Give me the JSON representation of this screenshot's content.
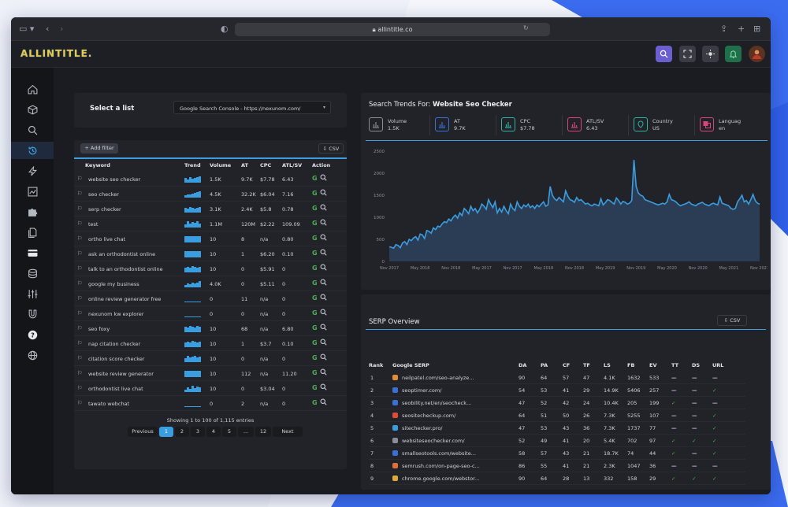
{
  "browser": {
    "url": "allintitle.co"
  },
  "app": {
    "logo": "ALLINTITLE."
  },
  "list": {
    "label": "Select a list",
    "selected": "Google Search Console - https://nexunom.com/"
  },
  "keywords": {
    "add_filter": "+ Add filter",
    "csv": "CSV",
    "columns": [
      "Keyword",
      "Trend",
      "Volume",
      "AT",
      "CPC",
      "ATL/SV",
      "Action"
    ],
    "rows": [
      {
        "kw": "website seo checker",
        "vol": "1.5K",
        "at": "9.7K",
        "cpc": "$7.78",
        "atsv": "6.43"
      },
      {
        "kw": "seo checker",
        "vol": "4.5K",
        "at": "32.2K",
        "cpc": "$6.04",
        "atsv": "7.16"
      },
      {
        "kw": "serp checker",
        "vol": "3.1K",
        "at": "2.4K",
        "cpc": "$5.8",
        "atsv": "0.78"
      },
      {
        "kw": "test",
        "vol": "1.1M",
        "at": "120M",
        "cpc": "$2.22",
        "atsv": "109.09"
      },
      {
        "kw": "ortho live chat",
        "vol": "10",
        "at": "8",
        "cpc": "n/a",
        "atsv": "0.80"
      },
      {
        "kw": "ask an orthodontist online",
        "vol": "10",
        "at": "1",
        "cpc": "$6.20",
        "atsv": "0.10"
      },
      {
        "kw": "talk to an orthodontist online",
        "vol": "10",
        "at": "0",
        "cpc": "$5.91",
        "atsv": "0"
      },
      {
        "kw": "google my business",
        "vol": "4.0K",
        "at": "0",
        "cpc": "$5.11",
        "atsv": "0"
      },
      {
        "kw": "online review generator free",
        "vol": "0",
        "at": "11",
        "cpc": "n/a",
        "atsv": "0"
      },
      {
        "kw": "nexunom kw explorer",
        "vol": "0",
        "at": "0",
        "cpc": "n/a",
        "atsv": "0"
      },
      {
        "kw": "seo foxy",
        "vol": "10",
        "at": "68",
        "cpc": "n/a",
        "atsv": "6.80"
      },
      {
        "kw": "nap citation checker",
        "vol": "10",
        "at": "1",
        "cpc": "$3.7",
        "atsv": "0.10"
      },
      {
        "kw": "citation score checker",
        "vol": "10",
        "at": "0",
        "cpc": "n/a",
        "atsv": "0"
      },
      {
        "kw": "website review generator",
        "vol": "10",
        "at": "112",
        "cpc": "n/a",
        "atsv": "11.20"
      },
      {
        "kw": "orthodontist live chat",
        "vol": "10",
        "at": "0",
        "cpc": "$3.04",
        "atsv": "0"
      },
      {
        "kw": "tawato webchat",
        "vol": "0",
        "at": "2",
        "cpc": "n/a",
        "atsv": "0"
      }
    ],
    "showing": "Showing 1 to 100 of 1,115 entries",
    "pagination": [
      "Previous",
      "1",
      "2",
      "3",
      "4",
      "5",
      "...",
      "12",
      "Next"
    ]
  },
  "trends": {
    "title_prefix": "Search Trends For:",
    "title_keyword": "Website Seo Checker",
    "metrics": [
      {
        "label": "Volume",
        "value": "1.5K",
        "color": "#8a8d95",
        "icon": "chart-icon"
      },
      {
        "label": "AT",
        "value": "9.7K",
        "color": "#3b6fd8",
        "icon": "chart-icon"
      },
      {
        "label": "CPC",
        "value": "$7.78",
        "color": "#2bb3a5",
        "icon": "chart-icon"
      },
      {
        "label": "ATL/SV",
        "value": "6.43",
        "color": "#d8457e",
        "icon": "chart-icon"
      },
      {
        "label": "Country",
        "value": "US",
        "color": "#2bb3a5",
        "icon": "pin-icon"
      },
      {
        "label": "Languag",
        "value": "en",
        "color": "#d8457e",
        "icon": "translate-icon"
      }
    ]
  },
  "chart_data": {
    "type": "area",
    "color": "#3a9de0",
    "yticks": [
      "0",
      "500",
      "1000",
      "1500",
      "2000",
      "2500"
    ],
    "xticks": [
      "Nov 2017",
      "May 2018",
      "Nov 2018",
      "May 2017",
      "Nov 2017",
      "May 2018",
      "Nov 2018",
      "May 2019",
      "Nov 2019",
      "May 2020",
      "Nov 2020",
      "May 2021",
      "Nov 2021"
    ],
    "ylim": [
      0,
      2500
    ],
    "values": [
      330,
      320,
      300,
      380,
      360,
      310,
      420,
      450,
      380,
      500,
      470,
      530,
      560,
      480,
      620,
      600,
      520,
      700,
      680,
      640,
      760,
      720,
      800,
      780,
      850,
      900,
      880,
      960,
      920,
      1000,
      1050,
      980,
      1100,
      1040,
      1200,
      1150,
      1080,
      1250,
      1150,
      1200,
      1100,
      1180,
      1300,
      1250,
      1180,
      1400,
      1300,
      1220,
      1350,
      1100,
      1200,
      1120,
      1250,
      1150,
      1080,
      1300,
      1200,
      1150,
      1350,
      1250,
      1200,
      1280,
      1240,
      1300,
      1220,
      1260,
      1200,
      1280,
      1240,
      1300,
      1350,
      1250,
      1280,
      1700,
      1500,
      1420,
      1380,
      1450,
      1400,
      1350,
      1600,
      1480,
      1400,
      1380,
      1340,
      1450,
      1380,
      1400,
      1350,
      1300,
      1320,
      1280,
      1260,
      1300,
      1280,
      1260,
      1420,
      1280,
      1330,
      1400,
      1380,
      1340,
      1300,
      1440,
      1380,
      1300,
      1360,
      1340,
      1300,
      1320,
      1380,
      2300,
      1700,
      1550,
      1500,
      1480,
      1400,
      1380,
      1360,
      1340,
      1320,
      1300,
      1280,
      1300,
      1320,
      1300,
      1350,
      1520,
      1400,
      1380,
      1350,
      1300,
      1260,
      1280,
      1300,
      1320,
      1350,
      1300,
      1280,
      1260,
      1300,
      1320,
      1340,
      1300,
      1280,
      1260,
      1300,
      1320,
      1300,
      1280,
      1460,
      1320,
      1300,
      1280,
      1260,
      1200,
      1180,
      1200,
      1350,
      1420,
      1500,
      1350,
      1380,
      1300,
      1400,
      1520,
      1380,
      1320,
      1300
    ]
  },
  "serp": {
    "title": "SERP Overview",
    "csv": "CSV",
    "columns": [
      "Rank",
      "Google SERP",
      "DA",
      "PA",
      "CF",
      "TF",
      "LS",
      "FB",
      "EV",
      "TT",
      "DS",
      "URL"
    ],
    "rows": [
      {
        "rank": "1",
        "url": "neilpatel.com/seo-analyze...",
        "da": "90",
        "pa": "64",
        "cf": "57",
        "tf": "47",
        "ls": "4.1K",
        "fb": "1632",
        "ev": "533",
        "icon_color": "#e08a3a",
        "tt": "—",
        "ds": "—",
        "u": "—"
      },
      {
        "rank": "2",
        "url": "seoptimer.com/",
        "da": "54",
        "pa": "53",
        "cf": "41",
        "tf": "29",
        "ls": "14.9K",
        "fb": "5406",
        "ev": "257",
        "icon_color": "#3b6fd8",
        "tt": "—",
        "ds": "—",
        "u": "✓"
      },
      {
        "rank": "3",
        "url": "seobility.net/en/seocheck...",
        "da": "47",
        "pa": "52",
        "cf": "42",
        "tf": "24",
        "ls": "10.4K",
        "fb": "205",
        "ev": "199",
        "icon_color": "#3b6fd8",
        "tt": "✓",
        "ds": "—",
        "u": "—"
      },
      {
        "rank": "4",
        "url": "seositecheckup.com/",
        "da": "64",
        "pa": "51",
        "cf": "50",
        "tf": "26",
        "ls": "7.3K",
        "fb": "5255",
        "ev": "107",
        "icon_color": "#e04a3a",
        "tt": "—",
        "ds": "—",
        "u": "✓"
      },
      {
        "rank": "5",
        "url": "sitechecker.pro/",
        "da": "47",
        "pa": "53",
        "cf": "43",
        "tf": "36",
        "ls": "7.3K",
        "fb": "1737",
        "ev": "77",
        "icon_color": "#3a9de0",
        "tt": "—",
        "ds": "—",
        "u": "✓"
      },
      {
        "rank": "6",
        "url": "websiteseochecker.com/",
        "da": "52",
        "pa": "49",
        "cf": "41",
        "tf": "20",
        "ls": "5.4K",
        "fb": "702",
        "ev": "97",
        "icon_color": "#8a8d95",
        "tt": "✓",
        "ds": "✓",
        "u": "✓"
      },
      {
        "rank": "7",
        "url": "smallseotools.com/website...",
        "da": "58",
        "pa": "57",
        "cf": "43",
        "tf": "21",
        "ls": "18.7K",
        "fb": "74",
        "ev": "44",
        "icon_color": "#3b6fd8",
        "tt": "✓",
        "ds": "—",
        "u": "✓"
      },
      {
        "rank": "8",
        "url": "semrush.com/on-page-seo-c...",
        "da": "86",
        "pa": "55",
        "cf": "41",
        "tf": "21",
        "ls": "2.3K",
        "fb": "1047",
        "ev": "36",
        "icon_color": "#e0703a",
        "tt": "—",
        "ds": "—",
        "u": "—"
      },
      {
        "rank": "9",
        "url": "chrome.google.com/webstor...",
        "da": "90",
        "pa": "64",
        "cf": "28",
        "tf": "13",
        "ls": "332",
        "fb": "158",
        "ev": "29",
        "icon_color": "#e0a83a",
        "tt": "✓",
        "ds": "✓",
        "u": "✓"
      }
    ]
  }
}
